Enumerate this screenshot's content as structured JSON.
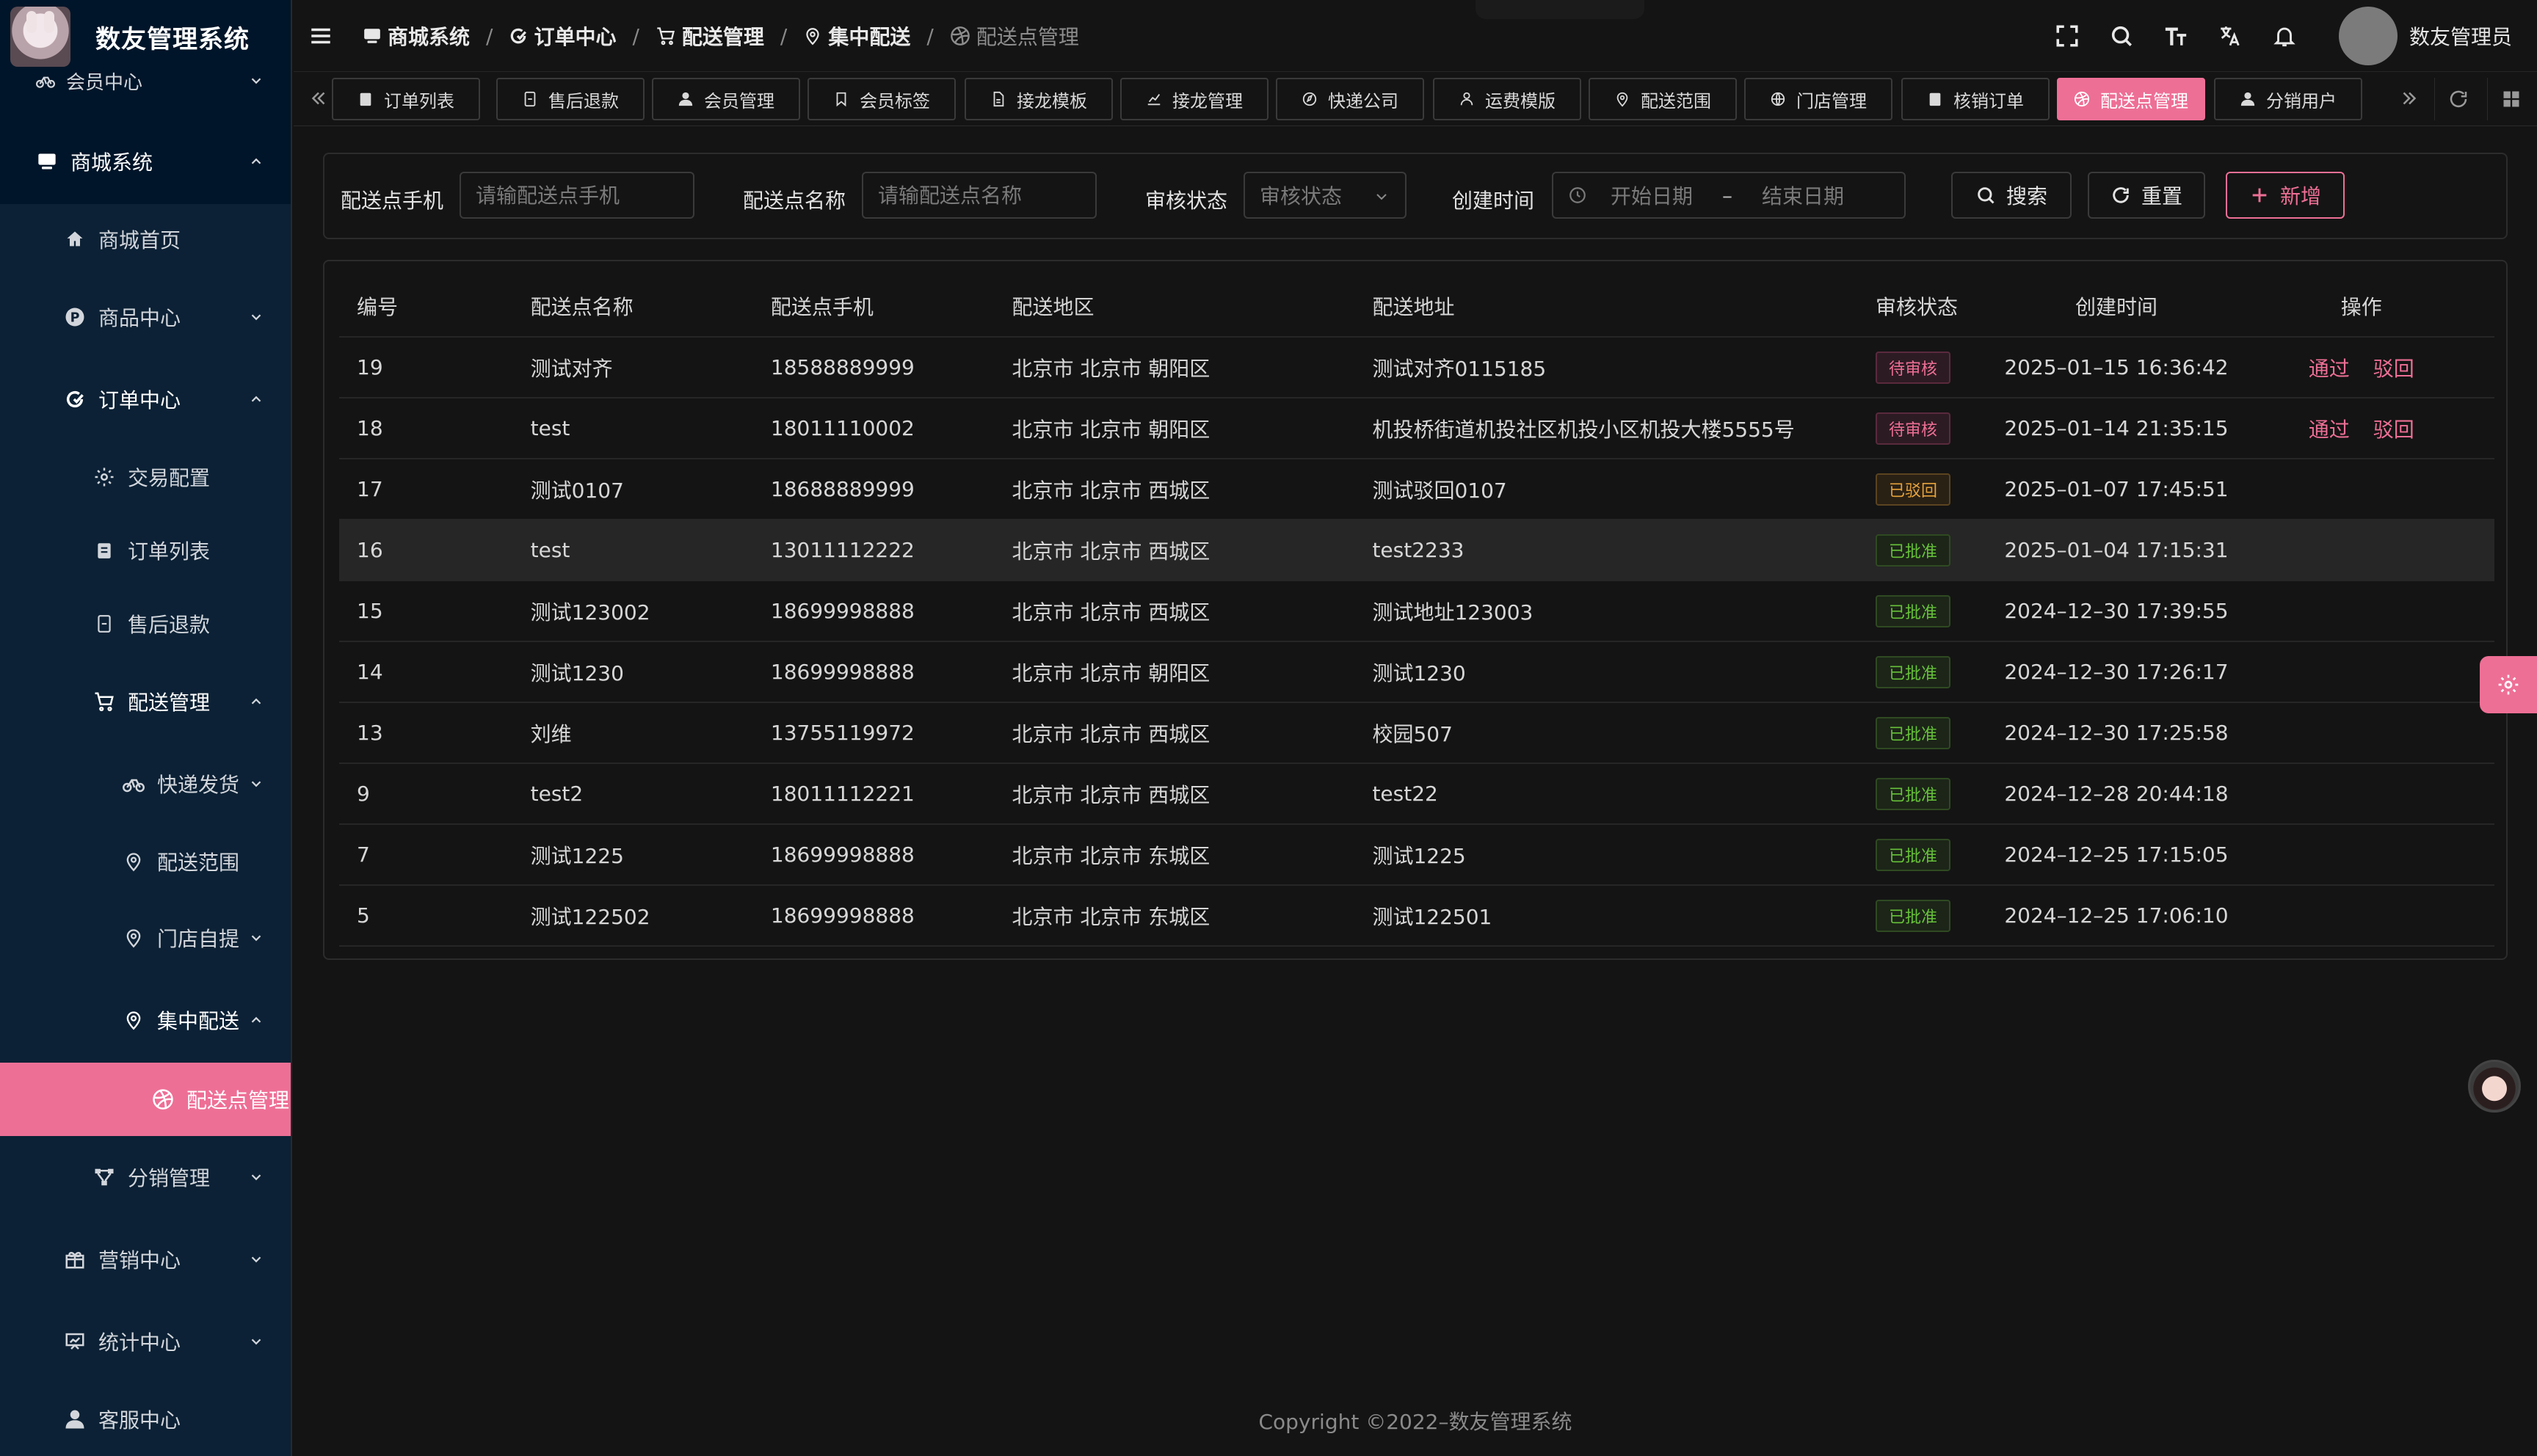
{
  "app": {
    "title": "数友管理系统"
  },
  "sidebar": {
    "member_center": "会员中心",
    "mall_system": "商城系统",
    "mall_home": "商城首页",
    "product_center": "商品中心",
    "order_center": "订单中心",
    "trade_config": "交易配置",
    "order_list": "订单列表",
    "after_sales": "售后退款",
    "delivery_mgmt": "配送管理",
    "express_shipping": "快递发货",
    "delivery_range": "配送范围",
    "store_pickup": "门店自提",
    "central_delivery": "集中配送",
    "delivery_point_mgmt": "配送点管理",
    "distribution_mgmt": "分销管理",
    "marketing_center": "营销中心",
    "stats_center": "统计中心",
    "service_center": "客服中心"
  },
  "breadcrumb": [
    "商城系统",
    "订单中心",
    "配送管理",
    "集中配送",
    "配送点管理"
  ],
  "header": {
    "user_name": "数友管理员"
  },
  "tabs": [
    {
      "label": "订单列表",
      "icon": "clipboard-icon"
    },
    {
      "label": "售后退款",
      "icon": "receipt-icon"
    },
    {
      "label": "会员管理",
      "icon": "user-icon"
    },
    {
      "label": "会员标签",
      "icon": "bookmark-icon"
    },
    {
      "label": "接龙模板",
      "icon": "document-icon"
    },
    {
      "label": "接龙管理",
      "icon": "chart-icon"
    },
    {
      "label": "快递公司",
      "icon": "compass-icon"
    },
    {
      "label": "运费模版",
      "icon": "person-icon"
    },
    {
      "label": "配送范围",
      "icon": "location-icon"
    },
    {
      "label": "门店管理",
      "icon": "globe-icon"
    },
    {
      "label": "核销订单",
      "icon": "clipboard-icon"
    },
    {
      "label": "配送点管理",
      "icon": "dribbble-icon"
    },
    {
      "label": "分销用户",
      "icon": "user-icon"
    }
  ],
  "search": {
    "phone_label": "配送点手机",
    "phone_placeholder": "请输配送点手机",
    "name_label": "配送点名称",
    "name_placeholder": "请输配送点名称",
    "status_label": "审核状态",
    "status_placeholder": "审核状态",
    "created_label": "创建时间",
    "start_placeholder": "开始日期",
    "range_sep": "–",
    "end_placeholder": "结束日期",
    "search_btn": "搜索",
    "reset_btn": "重置",
    "add_btn": "新增"
  },
  "table": {
    "columns": [
      "编号",
      "配送点名称",
      "配送点手机",
      "配送地区",
      "配送地址",
      "审核状态",
      "创建时间",
      "操作"
    ],
    "approve_label": "通过",
    "reject_label": "驳回",
    "rows": [
      {
        "id": "19",
        "name": "测试对齐",
        "phone": "18588889999",
        "region": "北京市 北京市 朝阳区",
        "address": "测试对齐0115185",
        "status": "待审核",
        "status_type": "pending",
        "created": "2025–01–15 16:36:42",
        "actions": true
      },
      {
        "id": "18",
        "name": "test",
        "phone": "18011110002",
        "region": "北京市 北京市 朝阳区",
        "address": "机投桥街道机投社区机投小区机投大楼5555号",
        "status": "待审核",
        "status_type": "pending",
        "created": "2025–01–14 21:35:15",
        "actions": true
      },
      {
        "id": "17",
        "name": "测试0107",
        "phone": "18688889999",
        "region": "北京市 北京市 西城区",
        "address": "测试驳回0107",
        "status": "已驳回",
        "status_type": "rejected",
        "created": "2025–01–07 17:45:51",
        "actions": false
      },
      {
        "id": "16",
        "name": "test",
        "phone": "13011112222",
        "region": "北京市 北京市 西城区",
        "address": "test2233",
        "status": "已批准",
        "status_type": "approved",
        "created": "2025–01–04 17:15:31",
        "actions": false
      },
      {
        "id": "15",
        "name": "测试123002",
        "phone": "18699998888",
        "region": "北京市 北京市 西城区",
        "address": "测试地址123003",
        "status": "已批准",
        "status_type": "approved",
        "created": "2024–12–30 17:39:55",
        "actions": false
      },
      {
        "id": "14",
        "name": "测试1230",
        "phone": "18699998888",
        "region": "北京市 北京市 朝阳区",
        "address": "测试1230",
        "status": "已批准",
        "status_type": "approved",
        "created": "2024–12–30 17:26:17",
        "actions": false
      },
      {
        "id": "13",
        "name": "刘维",
        "phone": "13755119972",
        "region": "北京市 北京市 西城区",
        "address": "校园507",
        "status": "已批准",
        "status_type": "approved",
        "created": "2024–12–30 17:25:58",
        "actions": false
      },
      {
        "id": "9",
        "name": "test2",
        "phone": "18011112221",
        "region": "北京市 北京市 西城区",
        "address": "test22",
        "status": "已批准",
        "status_type": "approved",
        "created": "2024–12–28 20:44:18",
        "actions": false
      },
      {
        "id": "7",
        "name": "测试1225",
        "phone": "18699998888",
        "region": "北京市 北京市 东城区",
        "address": "测试1225",
        "status": "已批准",
        "status_type": "approved",
        "created": "2024–12–25 17:15:05",
        "actions": false
      },
      {
        "id": "5",
        "name": "测试122502",
        "phone": "18699998888",
        "region": "北京市 北京市 东城区",
        "address": "测试122501",
        "status": "已批准",
        "status_type": "approved",
        "created": "2024–12–25 17:06:10",
        "actions": false
      }
    ]
  },
  "footer": {
    "copyright": "Copyright ©2022–数友管理系统"
  },
  "colors": {
    "accent": "#ee6f96",
    "sidebar_bg": "#001529",
    "page_bg": "#141414"
  }
}
